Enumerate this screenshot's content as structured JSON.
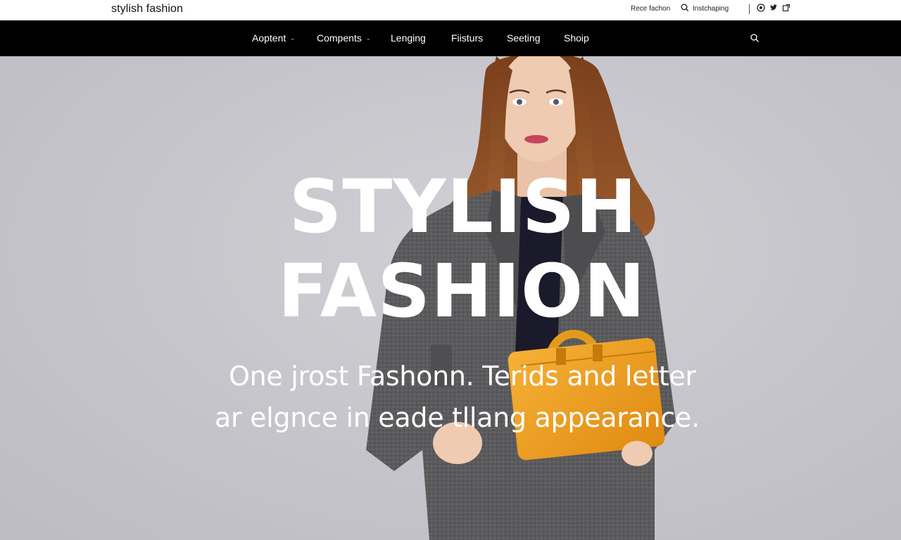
{
  "header": {
    "brand": "stylish fashion",
    "util_free": "Rece fachon",
    "util_instant": "Instchaping",
    "social": [
      "instagram-icon",
      "twitter-icon",
      "share-icon"
    ]
  },
  "nav": {
    "items": [
      {
        "label": "Aoptent",
        "has_dropdown": true
      },
      {
        "label": "Compents",
        "has_dropdown": true
      },
      {
        "label": "Lenging",
        "has_dropdown": false
      },
      {
        "label": "Fiisturs",
        "has_dropdown": false
      },
      {
        "label": "Seeting",
        "has_dropdown": false
      },
      {
        "label": "Shoip",
        "has_dropdown": false
      }
    ],
    "caret": "⌄"
  },
  "hero": {
    "title_line1": "STYLISH",
    "title_line2": "FASHION",
    "subtitle_line1": "One jrost Fashonn. Terids and letter",
    "subtitle_line2": "ar elgnce in eade tllang appearance."
  },
  "colors": {
    "topbar_bg": "#ffffff",
    "nav_bg": "#000000",
    "hero_bg": "#c8c7cc",
    "coat": "#5a5a5c",
    "bag": "#f2a01e",
    "hair": "#8a4a22"
  }
}
